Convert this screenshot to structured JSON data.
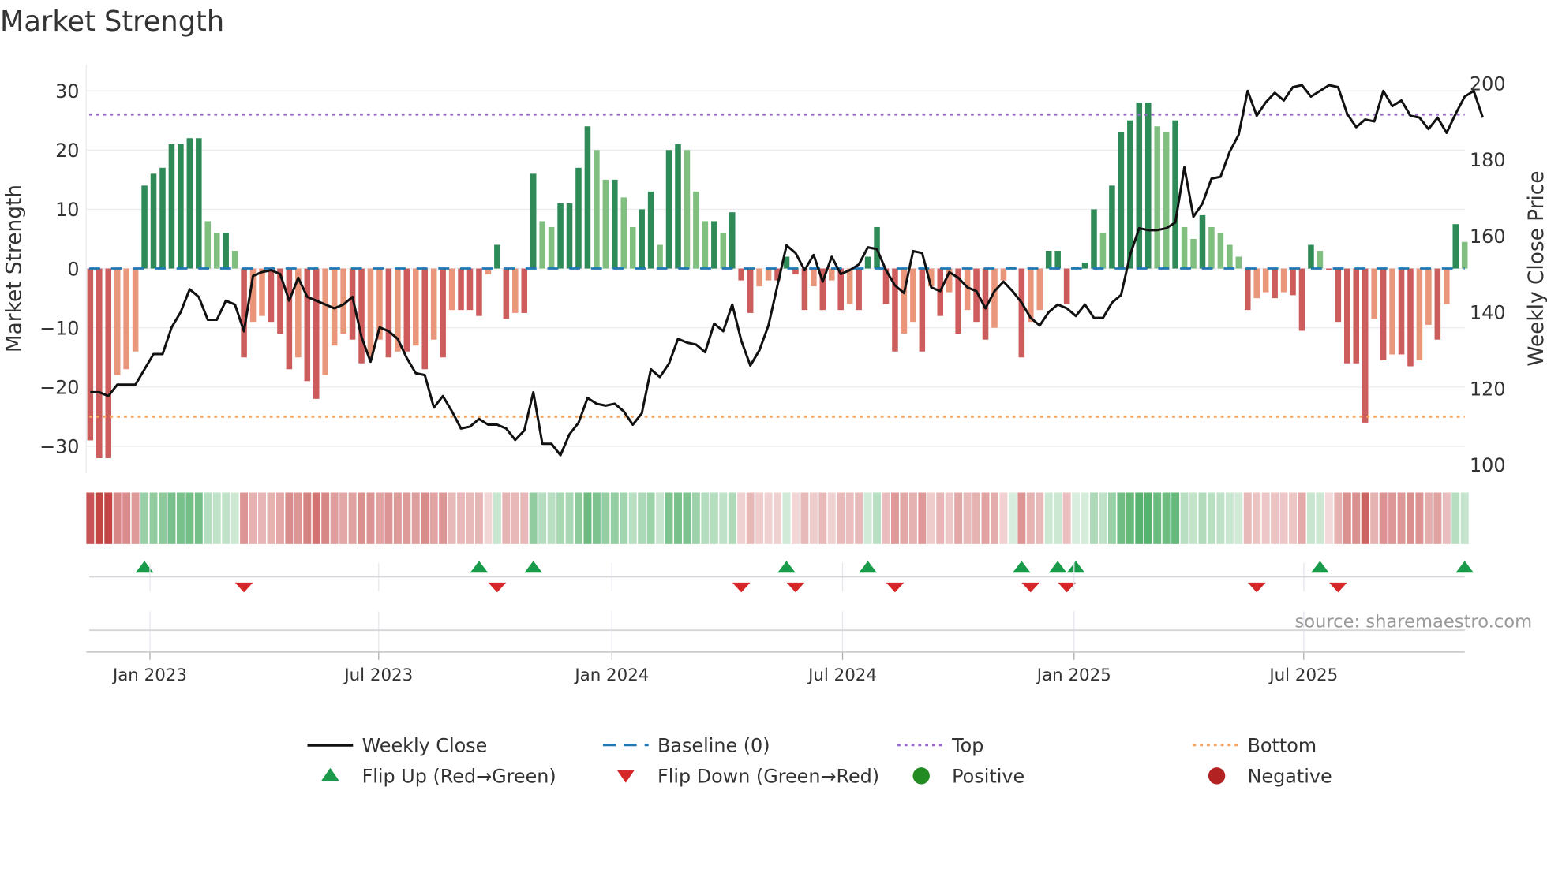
{
  "chart_data": {
    "type": "bar",
    "title": "Market Strength",
    "ylabel": "Market Strength",
    "y2label": "Weekly Close Price",
    "ylim": [
      -33,
      34
    ],
    "y2lim": [
      100,
      204
    ],
    "yticks": [
      30,
      20,
      10,
      0,
      -10,
      -20,
      -30
    ],
    "ytick_labels": [
      "30",
      "20",
      "10",
      "0",
      "−10",
      "−20",
      "−30"
    ],
    "y2ticks": [
      200,
      180,
      160,
      140,
      120,
      100
    ],
    "y2tick_labels": [
      "200",
      "180",
      "160",
      "140",
      "120",
      "100"
    ],
    "x_unit": "week index",
    "xticks": [
      {
        "label": "Jan 2023",
        "week": 6.6
      },
      {
        "label": "Jul 2023",
        "week": 31.9
      },
      {
        "label": "Jan 2024",
        "week": 57.7
      },
      {
        "label": "Jul 2024",
        "week": 83.2
      },
      {
        "label": "Jan 2025",
        "week": 108.8
      },
      {
        "label": "Jul 2025",
        "week": 134.2
      }
    ],
    "top_level": 26,
    "bottom_level": -25,
    "baseline": 0,
    "strength": [
      -29,
      -32,
      -32,
      -18,
      -17,
      -14,
      14,
      16,
      17,
      21,
      21,
      22,
      22,
      8,
      6,
      6,
      3,
      -15,
      -9,
      -8,
      -9,
      -11,
      -17,
      -15,
      -19,
      -22,
      -18,
      -13,
      -11,
      -12,
      -16,
      -15,
      -12,
      -15,
      -14,
      -14,
      -13,
      -17,
      -12,
      -15,
      -7,
      -7,
      -7,
      -8,
      -1,
      4,
      -8.5,
      -7.5,
      -7.5,
      16,
      8,
      7,
      11,
      11,
      17,
      24,
      20,
      15,
      15,
      12,
      7,
      10,
      13,
      4,
      20,
      21,
      20,
      13,
      8,
      8,
      6,
      9.5,
      -2,
      -7.5,
      -3,
      -2,
      -2,
      2,
      -1,
      -7,
      -3,
      -7,
      -2,
      -7,
      -6,
      -7,
      2,
      7,
      -6,
      -14,
      -11,
      -9,
      -14,
      -3,
      -8,
      -4,
      -11,
      -7,
      -9,
      -12,
      -10,
      -2,
      0.3,
      -15,
      -9,
      -7,
      3,
      3,
      -6,
      0.3,
      1,
      10,
      6,
      14,
      23,
      25,
      28,
      28,
      24,
      23,
      25,
      7,
      5,
      9,
      7,
      6,
      4,
      2,
      -7,
      -5,
      -4,
      -5,
      -4,
      -4.5,
      -10.5,
      4,
      3,
      -0.3,
      -9,
      -16,
      -16,
      -26,
      -8.5,
      -15.5,
      -14.5,
      -14.5,
      -16.5,
      -15.5,
      -9.5,
      -12,
      -6,
      7.5,
      4.5
    ],
    "weekly_close": [
      119,
      119,
      118,
      121,
      121,
      121,
      125,
      129,
      129,
      136,
      140,
      146,
      144,
      138,
      138,
      143,
      142,
      135,
      149.5,
      150.5,
      151,
      150,
      143,
      149,
      144,
      143,
      142,
      141,
      142,
      144,
      133.5,
      127,
      136,
      135,
      133,
      128,
      124,
      123.5,
      115,
      118,
      114,
      109.5,
      110,
      112,
      110.5,
      110.5,
      109.5,
      106.5,
      109,
      119,
      105.5,
      105.5,
      102.5,
      108,
      111,
      117.5,
      116,
      115.5,
      116,
      114,
      110.5,
      113.5,
      125,
      123,
      126.5,
      133,
      132,
      131.5,
      129.5,
      137,
      135,
      142,
      132.5,
      126,
      130,
      136.5,
      147,
      157.5,
      155.5,
      151,
      155,
      148,
      154.5,
      150,
      151,
      152.5,
      157,
      156.5,
      151,
      147,
      145,
      156,
      155.5,
      146.5,
      145.5,
      150.5,
      149,
      146.5,
      145.5,
      141,
      145.5,
      148,
      145.5,
      142.5,
      138.5,
      136.5,
      140,
      142,
      141,
      139,
      142,
      138.5,
      138.5,
      142.5,
      144.5,
      155,
      162,
      161.5,
      161.5,
      162,
      163.5,
      178,
      165,
      168.5,
      175,
      175.5,
      182,
      186.5,
      198,
      191.5,
      195,
      197.5,
      195.5,
      199,
      199.5,
      196.5,
      198,
      199.5,
      199,
      192,
      188.5,
      190.5,
      190,
      198,
      194,
      195.5,
      191.5,
      191,
      188,
      191,
      187,
      192,
      196.5,
      198,
      191
    ],
    "flip_up_weeks": [
      6,
      43,
      49,
      77,
      86,
      103,
      107,
      109,
      136,
      152
    ],
    "flip_down_weeks": [
      17,
      45,
      72,
      78,
      89,
      104,
      108,
      129,
      138
    ],
    "colors": {
      "pos_strong": "#2e8b57",
      "pos_weak": "#80bf80",
      "neg_strong": "#cd5c5c",
      "neg_weak": "#e9967a",
      "top": "#9966cc",
      "bottom": "#f4a460",
      "baseline": "#1f77b4",
      "flip_up": "#1a9a4a",
      "flip_down": "#d62728"
    },
    "legend": {
      "placement": "bottom",
      "items": [
        "Weekly Close",
        "Baseline (0)",
        "Top",
        "Bottom",
        "Flip Up (Red→Green)",
        "Flip Down (Green→Red)",
        "Positive",
        "Negative"
      ]
    },
    "source": "source: sharemaestro.com"
  }
}
